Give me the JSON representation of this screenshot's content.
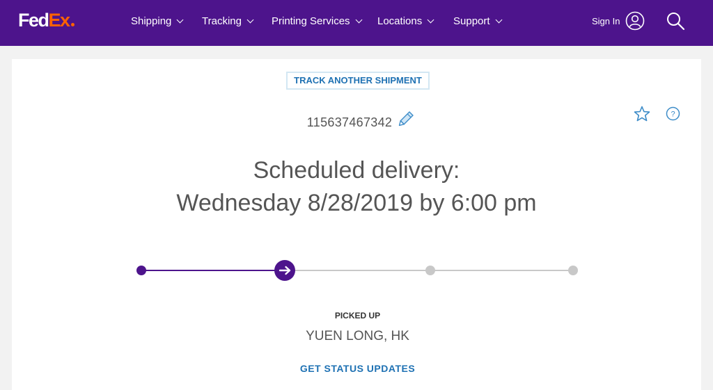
{
  "header": {
    "logo": {
      "part1": "Fed",
      "part2": "Ex"
    },
    "nav": [
      {
        "label": "Shipping"
      },
      {
        "label": "Tracking"
      },
      {
        "label": "Printing Services"
      },
      {
        "label": "Locations"
      },
      {
        "label": "Support"
      }
    ],
    "sign_in_label": "Sign In",
    "icons": {
      "account": "user-icon",
      "search": "search-icon"
    }
  },
  "tracking": {
    "track_another_label": "TRACK ANOTHER SHIPMENT",
    "number": "115637467342",
    "icons": {
      "edit": "pencil-icon",
      "favorite": "star-icon",
      "help": "help-icon"
    },
    "delivery_heading": "Scheduled delivery:",
    "delivery_date": "Wednesday 8/28/2019 by 6:00 pm",
    "progress": {
      "steps": 4,
      "current_step": 2
    },
    "status_label": "PICKED UP",
    "location": "YUEN LONG, HK",
    "status_updates_label": "GET STATUS UPDATES"
  },
  "colors": {
    "brand_purple": "#4d148c",
    "brand_orange": "#ff6200",
    "link_blue": "#1e71b3",
    "progress_inactive": "#c8c8c8"
  }
}
